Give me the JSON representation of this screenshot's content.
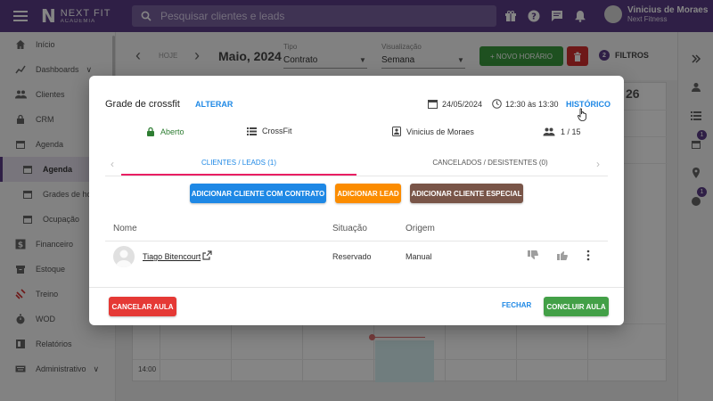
{
  "colors": {
    "brand": "#5b3d86",
    "primary_blue": "#1e88e5",
    "lead_orange": "#fb8c00",
    "special_brown": "#795548",
    "danger": "#e53935",
    "success": "#43a047",
    "tab_underline": "#e91e63"
  },
  "topbar": {
    "brand_name": "NEXT FIT",
    "brand_sub": "ACADEMIA",
    "search_placeholder": "Pesquisar clientes e leads",
    "user_name": "Vinicius de Moraes",
    "user_org": "Next Fitness",
    "icons": [
      "gift-icon",
      "help-icon",
      "chat-icon",
      "bell-icon"
    ]
  },
  "sidebar": {
    "items": [
      {
        "label": "Início",
        "icon": "home-icon"
      },
      {
        "label": "Dashboards",
        "icon": "chart-icon",
        "chevron": "∨"
      },
      {
        "label": "Clientes",
        "icon": "people-icon"
      },
      {
        "label": "CRM",
        "icon": "lock-icon"
      },
      {
        "label": "Agenda",
        "icon": "calendar-icon"
      },
      {
        "label": "Agenda",
        "icon": "calendar-icon",
        "sub": true,
        "active": true
      },
      {
        "label": "Grades de horá",
        "icon": "calendar-icon",
        "sub": true
      },
      {
        "label": "Ocupação",
        "icon": "calendar-icon",
        "sub": true
      },
      {
        "label": "Financeiro",
        "icon": "dollar-icon"
      },
      {
        "label": "Estoque",
        "icon": "box-icon"
      },
      {
        "label": "Treino",
        "icon": "dumbbell-icon"
      },
      {
        "label": "WOD",
        "icon": "stopwatch-icon"
      },
      {
        "label": "Relatórios",
        "icon": "report-icon"
      },
      {
        "label": "Administrativo",
        "icon": "keyboard-icon",
        "chevron": "∨"
      }
    ]
  },
  "toolbar": {
    "hoje": "HOJE",
    "month": "Maio, 2024",
    "tipo_label": "Tipo",
    "tipo_value": "Contrato",
    "visualizacao_label": "Visualização",
    "visualizacao_value": "Semana",
    "novo_horario": "+ NOVO HORÁRIO",
    "filtros": "FILTROS",
    "filtros_count": "2"
  },
  "calendar": {
    "day_number": "26",
    "time_label": "14:00"
  },
  "right_rail": {
    "badges": [
      "1",
      "1"
    ]
  },
  "modal": {
    "title": "Grade de crossfit",
    "alterar": "ALTERAR",
    "date": "24/05/2024",
    "time": "12:30 às 13:30",
    "historico": "HISTÓRICO",
    "status": "Aberto",
    "modality": "CrossFit",
    "instructor": "Vinicius de Moraes",
    "capacity": "1 / 15",
    "tab_clients": "CLIENTES / LEADS (1)",
    "tab_cancelled": "CANCELADOS / DESISTENTES (0)",
    "btn_add_contract": "ADICIONAR CLIENTE COM CONTRATO",
    "btn_add_lead": "ADICIONAR LEAD",
    "btn_add_special": "ADICIONAR CLIENTE ESPECIAL",
    "columns": {
      "name": "Nome",
      "situation": "Situação",
      "origin": "Origem"
    },
    "rows": [
      {
        "name": "Tiago Bitencourt",
        "situation": "Reservado",
        "origin": "Manual"
      }
    ],
    "btn_cancel": "CANCELAR AULA",
    "btn_close": "FECHAR",
    "btn_finish": "CONCLUIR AULA"
  }
}
